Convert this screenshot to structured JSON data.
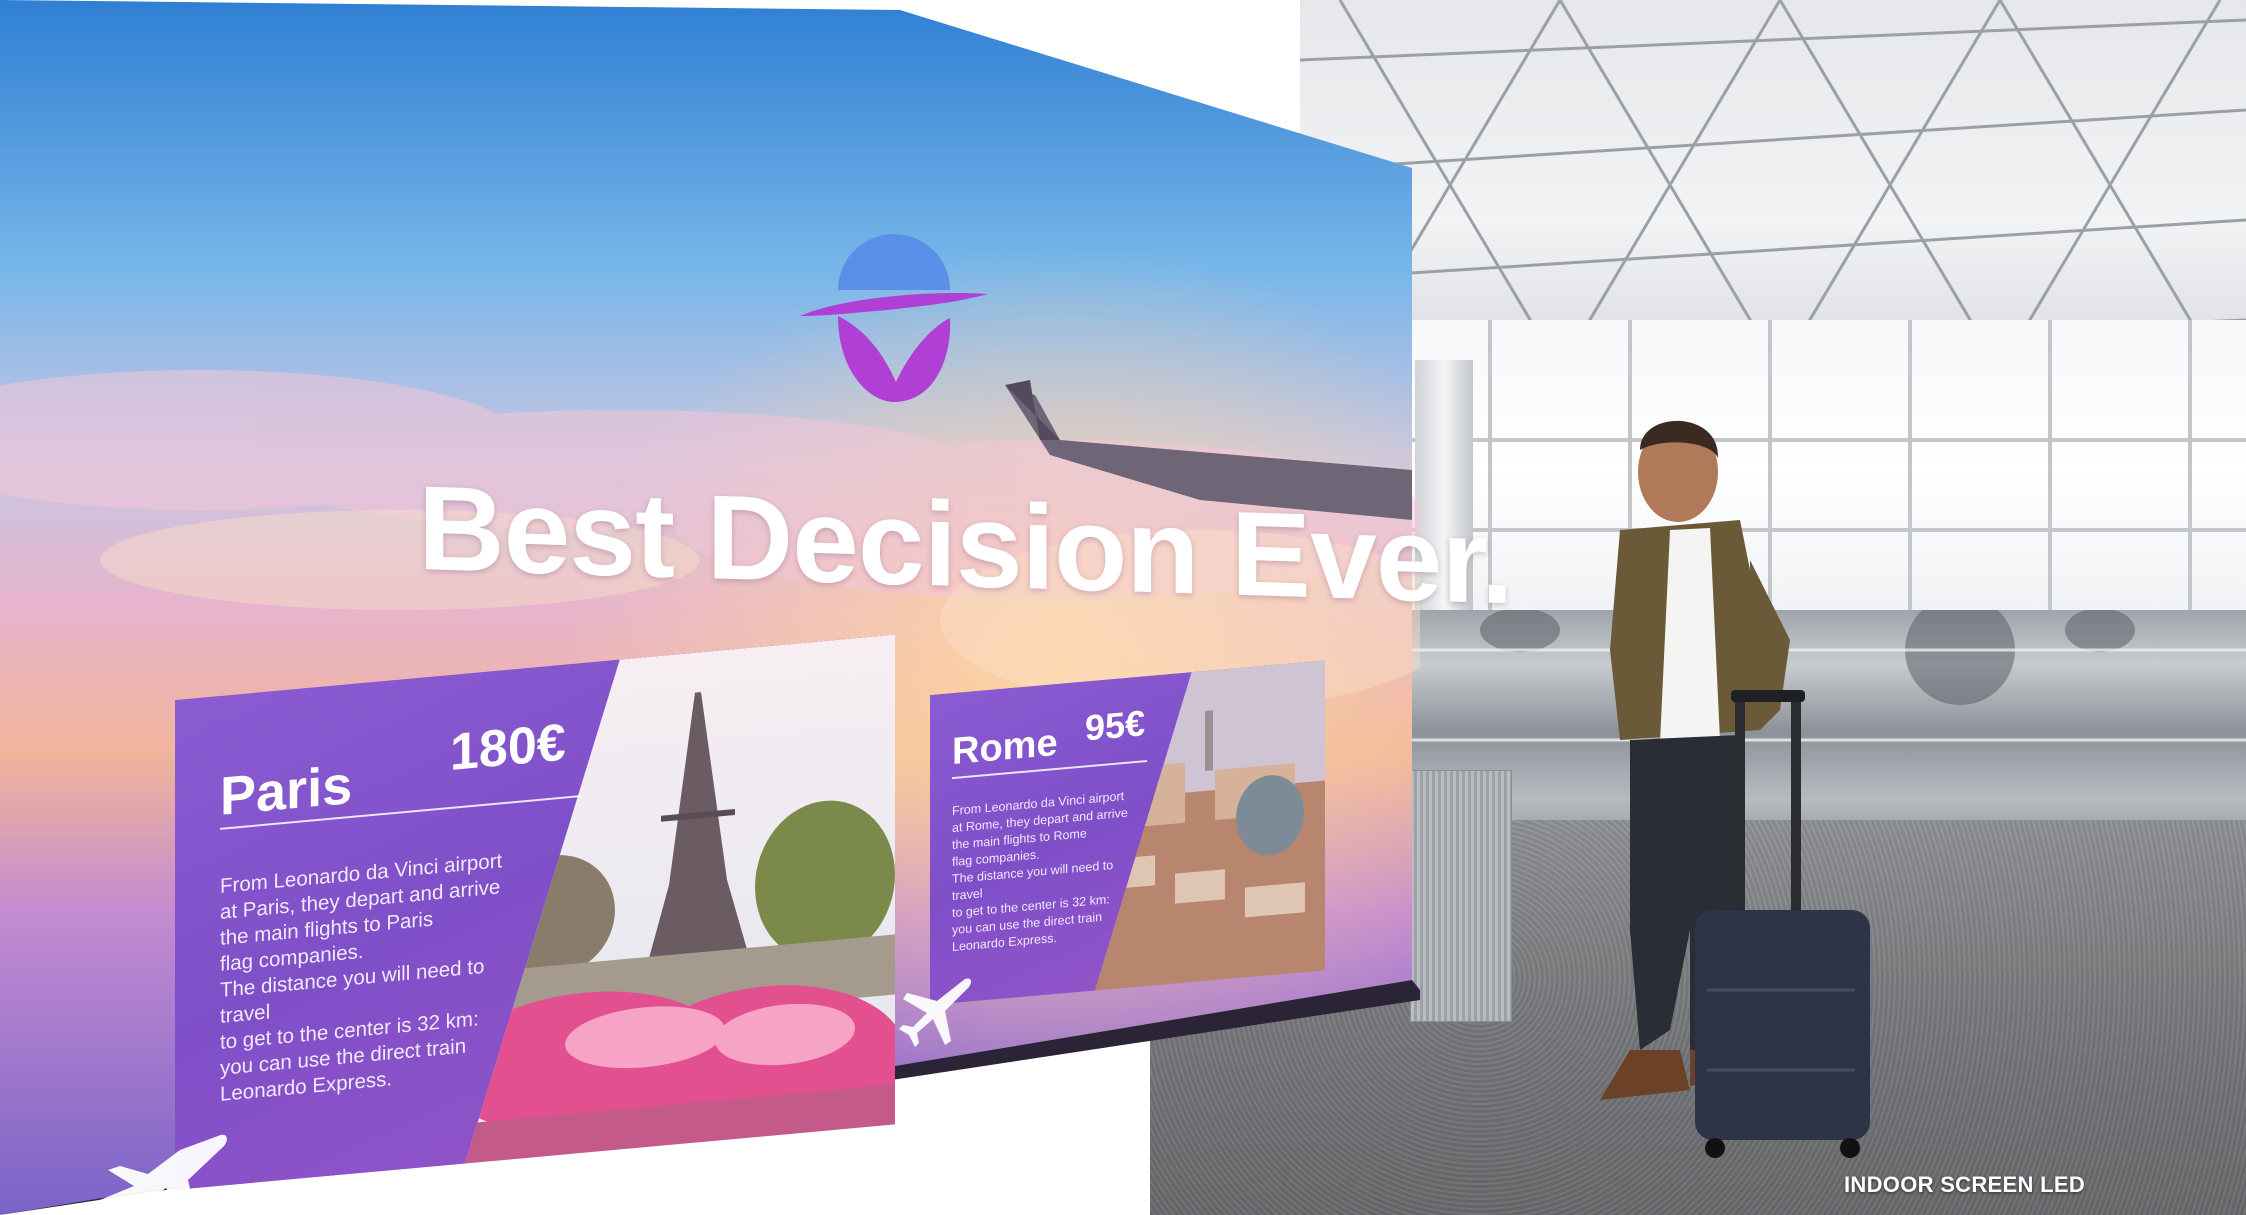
{
  "ad": {
    "headline": "Best Decision Ever.",
    "logo_icon": "travel-brand-logo-icon",
    "colors": {
      "sky_top": "#3f8fd8",
      "sky_mid": "#d9a9d6",
      "card_purple": "#8a5bd1",
      "logo_blue": "#5b8fe8",
      "logo_magenta": "#b03fd6"
    }
  },
  "cards": [
    {
      "city": "Paris",
      "price": "180€",
      "body": "From Leonardo da Vinci airport\nat Paris, they depart and arrive\nthe main flights to Paris\nflag companies.\nThe distance you will need to travel\nto get to the center is 32 km:\nyou can use the direct train\nLeonardo Express.",
      "photo": "eiffel-tower-photo"
    },
    {
      "city": "Rome",
      "price": "95€",
      "body": "From Leonardo da Vinci airport\nat Rome, they depart and arrive\nthe main flights to Rome\nflag companies.\nThe distance you will need to travel\nto get to the center is 32 km:\nyou can use the direct train\nLeonardo Express.",
      "photo": "rome-cityscape-photo"
    }
  ],
  "caption": "INDOOR SCREEN LED"
}
